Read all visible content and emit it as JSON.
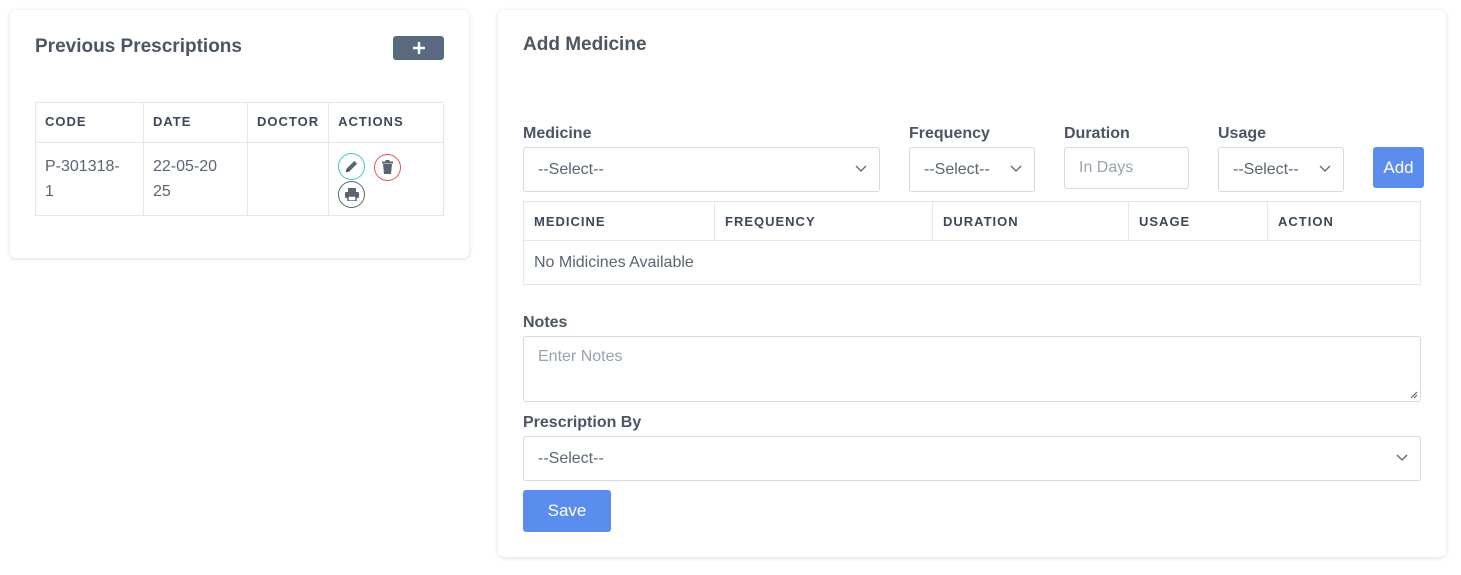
{
  "prev": {
    "title": "Previous Prescriptions",
    "add_icon": "plus-icon",
    "columns": [
      "CODE",
      "DATE",
      "DOCTOR",
      "ACTIONS"
    ],
    "rows": [
      {
        "code": "P-301318-1",
        "date": "22-05-2025",
        "doctor": ""
      }
    ],
    "action_icons": [
      "edit-icon",
      "trash-icon",
      "print-icon"
    ],
    "colors": {
      "edit": "#3ec6c6",
      "delete": "#e8505b",
      "print": "#5a6573"
    }
  },
  "add_medicine": {
    "title": "Add Medicine",
    "medicine_label": "Medicine",
    "medicine_value": "--Select--",
    "frequency_label": "Frequency",
    "frequency_value": "--Select--",
    "duration_label": "Duration",
    "duration_placeholder": "In Days",
    "usage_label": "Usage",
    "usage_value": "--Select--",
    "add_button": "Add",
    "table_columns": [
      "MEDICINE",
      "FREQUENCY",
      "DURATION",
      "USAGE",
      "ACTION"
    ],
    "empty_text": "No Midicines Available",
    "notes_label": "Notes",
    "notes_placeholder": "Enter Notes",
    "prescription_by_label": "Prescription By",
    "prescription_by_value": "--Select--",
    "save_button": "Save"
  },
  "colors": {
    "primary": "#5b8def",
    "dark_button": "#5a6a7e"
  }
}
